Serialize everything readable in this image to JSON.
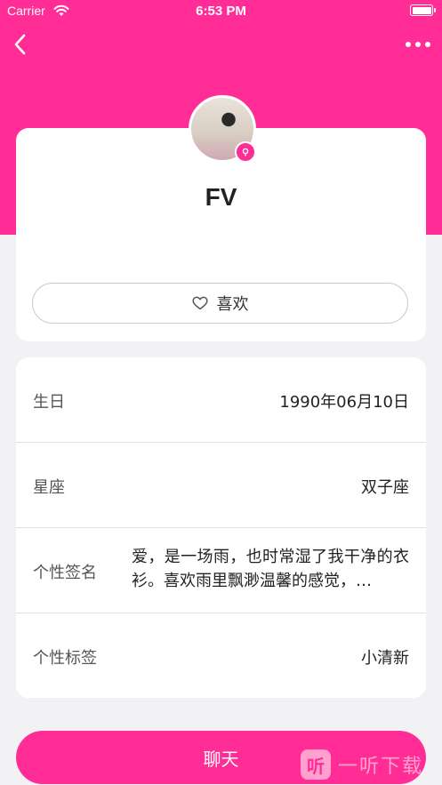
{
  "status_bar": {
    "carrier": "Carrier",
    "time": "6:53 PM"
  },
  "profile": {
    "name": "FV",
    "like_label": "喜欢"
  },
  "info_rows": [
    {
      "label": "生日",
      "value": "1990年06月10日"
    },
    {
      "label": "星座",
      "value": "双子座"
    },
    {
      "label": "个性签名",
      "value": "爱，是一场雨，也时常湿了我干净的衣衫。喜欢雨里飘渺温馨的感觉，…"
    },
    {
      "label": "个性标签",
      "value": "小清新"
    }
  ],
  "chat_label": "聊天",
  "watermark": {
    "logo": "听",
    "text": "一听下载"
  },
  "colors": {
    "accent": "#ff2d95",
    "background": "#f2f2f4"
  }
}
